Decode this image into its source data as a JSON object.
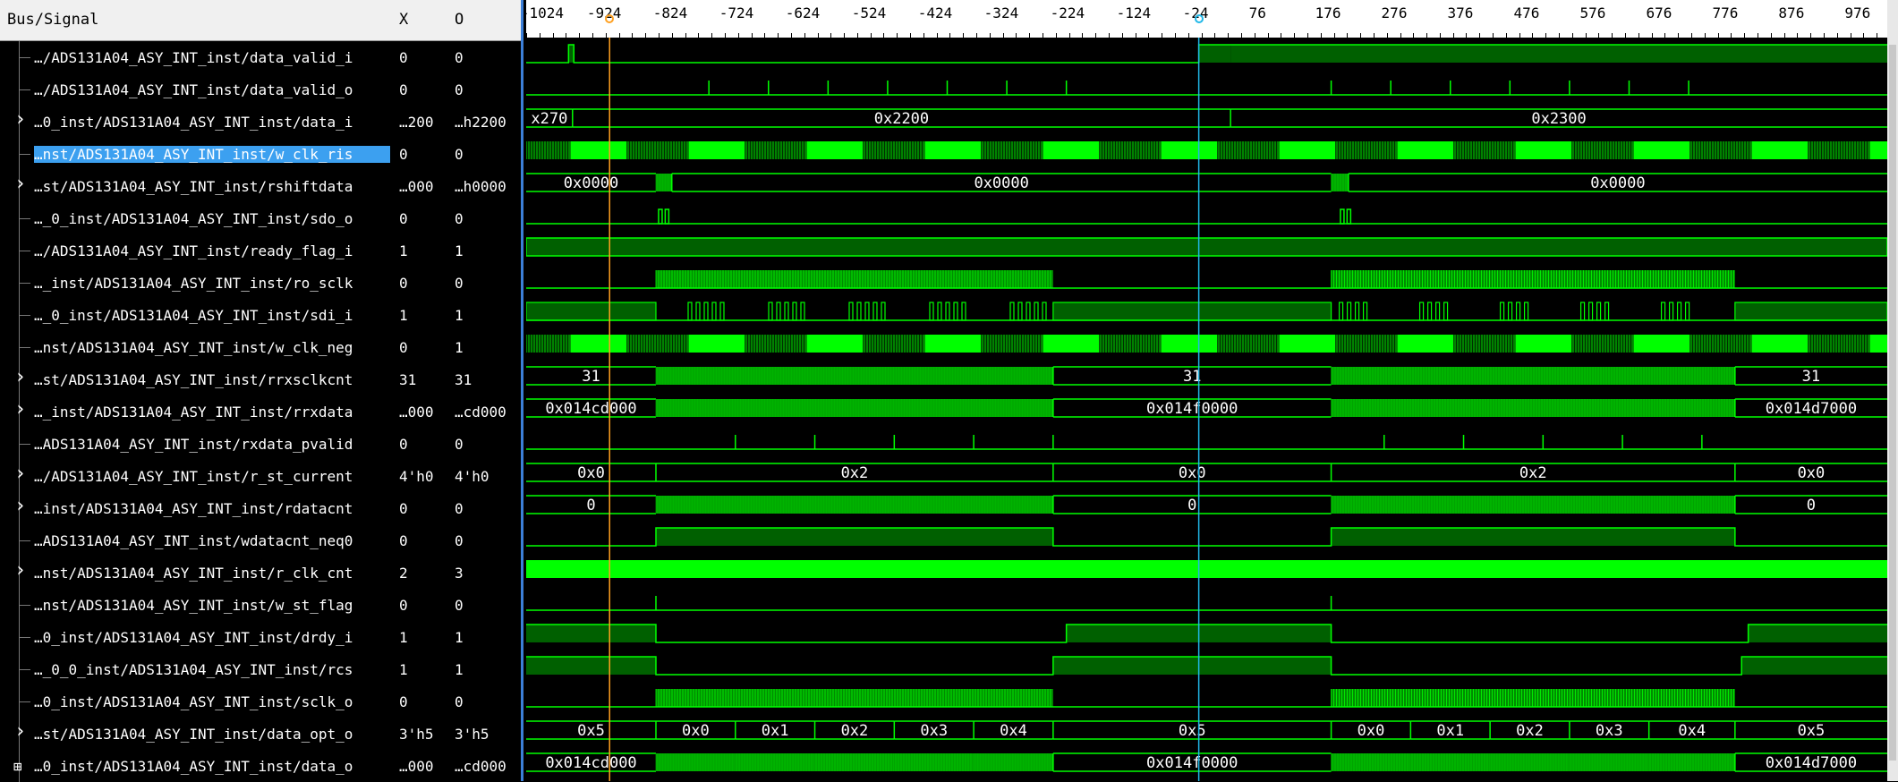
{
  "header": {
    "col_name": "Bus/Signal",
    "col_x": "X",
    "col_o": "O"
  },
  "ruler": {
    "ticks": [
      "-1024",
      "-924",
      "-824",
      "-724",
      "-624",
      "-524",
      "-424",
      "-324",
      "-224",
      "-124",
      "-24",
      "76",
      "176",
      "276",
      "376",
      "476",
      "576",
      "676",
      "776",
      "876",
      "976"
    ]
  },
  "cursors": {
    "yellow_time": -914,
    "cyan_time": -24
  },
  "signals": [
    {
      "name": "…/ADS131A04_ASY_INT_inst/data_valid_i",
      "x": "0",
      "o": "0",
      "expandable": false
    },
    {
      "name": "…/ADS131A04_ASY_INT_inst/data_valid_o",
      "x": "0",
      "o": "0",
      "expandable": false
    },
    {
      "name": "…0_inst/ADS131A04_ASY_INT_inst/data_i",
      "x": "…200",
      "o": "…h2200",
      "expandable": true
    },
    {
      "name": "…nst/ADS131A04_ASY_INT_inst/w_clk_ris",
      "x": "0",
      "o": "0",
      "expandable": false,
      "selected": true
    },
    {
      "name": "…st/ADS131A04_ASY_INT_inst/rshiftdata",
      "x": "…000",
      "o": "…h0000",
      "expandable": true
    },
    {
      "name": "…_0_inst/ADS131A04_ASY_INT_inst/sdo_o",
      "x": "0",
      "o": "0",
      "expandable": false
    },
    {
      "name": "…/ADS131A04_ASY_INT_inst/ready_flag_i",
      "x": "1",
      "o": "1",
      "expandable": false
    },
    {
      "name": "…_inst/ADS131A04_ASY_INT_inst/ro_sclk",
      "x": "0",
      "o": "0",
      "expandable": false
    },
    {
      "name": "…_0_inst/ADS131A04_ASY_INT_inst/sdi_i",
      "x": "1",
      "o": "1",
      "expandable": false
    },
    {
      "name": "…nst/ADS131A04_ASY_INT_inst/w_clk_neg",
      "x": "0",
      "o": "1",
      "expandable": false
    },
    {
      "name": "…st/ADS131A04_ASY_INT_inst/rrxsclkcnt",
      "x": "31",
      "o": "31",
      "expandable": true
    },
    {
      "name": "…_inst/ADS131A04_ASY_INT_inst/rrxdata",
      "x": "…000",
      "o": "…cd000",
      "expandable": true
    },
    {
      "name": "…ADS131A04_ASY_INT_inst/rxdata_pvalid",
      "x": "0",
      "o": "0",
      "expandable": false
    },
    {
      "name": "…/ADS131A04_ASY_INT_inst/r_st_current",
      "x": "4'h0",
      "o": "4'h0",
      "expandable": true
    },
    {
      "name": "…inst/ADS131A04_ASY_INT_inst/rdatacnt",
      "x": "0",
      "o": "0",
      "expandable": true
    },
    {
      "name": "…ADS131A04_ASY_INT_inst/wdatacnt_neq0",
      "x": "0",
      "o": "0",
      "expandable": false
    },
    {
      "name": "…nst/ADS131A04_ASY_INT_inst/r_clk_cnt",
      "x": "2",
      "o": "3",
      "expandable": true
    },
    {
      "name": "…nst/ADS131A04_ASY_INT_inst/w_st_flag",
      "x": "0",
      "o": "0",
      "expandable": false
    },
    {
      "name": "…0_inst/ADS131A04_ASY_INT_inst/drdy_i",
      "x": "1",
      "o": "1",
      "expandable": false
    },
    {
      "name": "…_0_0_inst/ADS131A04_ASY_INT_inst/rcs",
      "x": "1",
      "o": "1",
      "expandable": false
    },
    {
      "name": "…0_inst/ADS131A04_ASY_INT_inst/sclk_o",
      "x": "0",
      "o": "0",
      "expandable": false
    },
    {
      "name": "…st/ADS131A04_ASY_INT_inst/data_opt_o",
      "x": "3'h5",
      "o": "3'h5",
      "expandable": true
    },
    {
      "name": "…0_inst/ADS131A04_ASY_INT_inst/data_o",
      "x": "…000",
      "o": "…cd000",
      "expandable": "plus"
    }
  ],
  "waves": {
    "view": {
      "t0": -1040,
      "t1": 1016
    },
    "rows": [
      {
        "kind": "bit",
        "init": 0,
        "edges": [
          [
            -976,
            1
          ],
          [
            -968,
            0
          ],
          [
            -24,
            1
          ],
          [
            -24,
            1
          ],
          [
            24,
            1
          ]
        ],
        "final": 1,
        "note": "data_valid_i"
      },
      {
        "kind": "pulses",
        "times": [
          -764,
          -674,
          -584,
          -494,
          -404,
          -314,
          -224,
          176,
          266,
          356,
          446,
          536,
          626,
          716
        ]
      },
      {
        "kind": "bus",
        "segs": [
          [
            -1040,
            "x270"
          ],
          [
            -970,
            "0x2200"
          ],
          [
            24,
            "0x2300"
          ]
        ]
      },
      {
        "kind": "dense",
        "pattern": "clk_ris"
      },
      {
        "kind": "bus",
        "segs": [
          [
            -1040,
            "0x0000"
          ],
          [
            -844,
            ""
          ],
          [
            -820,
            "0x0000"
          ],
          [
            176,
            ""
          ],
          [
            202,
            "0x0000"
          ]
        ]
      },
      {
        "kind": "pulses2",
        "times": [
          -840,
          -830,
          190,
          200
        ]
      },
      {
        "kind": "high"
      },
      {
        "kind": "dense2",
        "ranges": [
          [
            -844,
            -244
          ],
          [
            176,
            786
          ]
        ]
      },
      {
        "kind": "sdi"
      },
      {
        "kind": "dense",
        "pattern": "clk_neg"
      },
      {
        "kind": "bus",
        "segs": [
          [
            -1040,
            "31"
          ],
          [
            -844,
            ""
          ],
          [
            -244,
            "31"
          ],
          [
            176,
            ""
          ],
          [
            786,
            "31"
          ]
        ],
        "labels_at": [
          -920,
          -24,
          880
        ]
      },
      {
        "kind": "bus",
        "segs": [
          [
            -1040,
            "0x014cd000"
          ],
          [
            -844,
            ""
          ],
          [
            -244,
            "0x014f0000"
          ],
          [
            176,
            ""
          ],
          [
            786,
            "0x014d7000"
          ]
        ]
      },
      {
        "kind": "pulses",
        "times": [
          -724,
          -604,
          -484,
          -364,
          -244,
          256,
          376,
          496,
          616,
          736
        ]
      },
      {
        "kind": "bus",
        "segs": [
          [
            -1040,
            "0x0"
          ],
          [
            -844,
            "0x2"
          ],
          [
            -244,
            "0x0"
          ],
          [
            176,
            "0x2"
          ],
          [
            786,
            "0x0"
          ]
        ]
      },
      {
        "kind": "bus",
        "segs": [
          [
            -1040,
            "0"
          ],
          [
            -844,
            ""
          ],
          [
            -244,
            "0"
          ],
          [
            176,
            ""
          ],
          [
            786,
            "0"
          ]
        ]
      },
      {
        "kind": "bit",
        "init": 0,
        "edges": [
          [
            -844,
            1
          ],
          [
            -244,
            0
          ],
          [
            176,
            1
          ],
          [
            786,
            0
          ]
        ],
        "final": 0
      },
      {
        "kind": "full"
      },
      {
        "kind": "pulses",
        "times": [
          -844,
          176
        ]
      },
      {
        "kind": "bit",
        "init": 1,
        "edges": [
          [
            -844,
            0
          ],
          [
            -224,
            1
          ],
          [
            176,
            0
          ],
          [
            806,
            1
          ]
        ],
        "final": 1
      },
      {
        "kind": "bit",
        "init": 1,
        "edges": [
          [
            -844,
            0
          ],
          [
            -244,
            1
          ],
          [
            176,
            0
          ],
          [
            796,
            1
          ]
        ],
        "final": 1
      },
      {
        "kind": "dense2",
        "ranges": [
          [
            -844,
            -244
          ],
          [
            176,
            786
          ]
        ]
      },
      {
        "kind": "bus",
        "segs": [
          [
            -1040,
            "0x5"
          ],
          [
            -844,
            "0x0"
          ],
          [
            -724,
            "0x1"
          ],
          [
            -604,
            "0x2"
          ],
          [
            -484,
            "0x3"
          ],
          [
            -364,
            "0x4"
          ],
          [
            -244,
            "0x5"
          ],
          [
            176,
            "0x0"
          ],
          [
            296,
            "0x1"
          ],
          [
            416,
            "0x2"
          ],
          [
            536,
            "0x3"
          ],
          [
            656,
            "0x4"
          ],
          [
            786,
            "0x5"
          ]
        ]
      },
      {
        "kind": "bus",
        "segs": [
          [
            -1040,
            "0x014cd000"
          ],
          [
            -844,
            ""
          ],
          [
            -724,
            ""
          ],
          [
            -604,
            ""
          ],
          [
            -484,
            ""
          ],
          [
            -364,
            ""
          ],
          [
            -244,
            "0x014f0000"
          ],
          [
            176,
            ""
          ],
          [
            296,
            ""
          ],
          [
            416,
            ""
          ],
          [
            536,
            ""
          ],
          [
            656,
            ""
          ],
          [
            786,
            "0x014d7000"
          ]
        ]
      }
    ]
  },
  "colors": {
    "wave": "#00ff00",
    "fill": "#006000",
    "selected": "#3ca0f0"
  }
}
